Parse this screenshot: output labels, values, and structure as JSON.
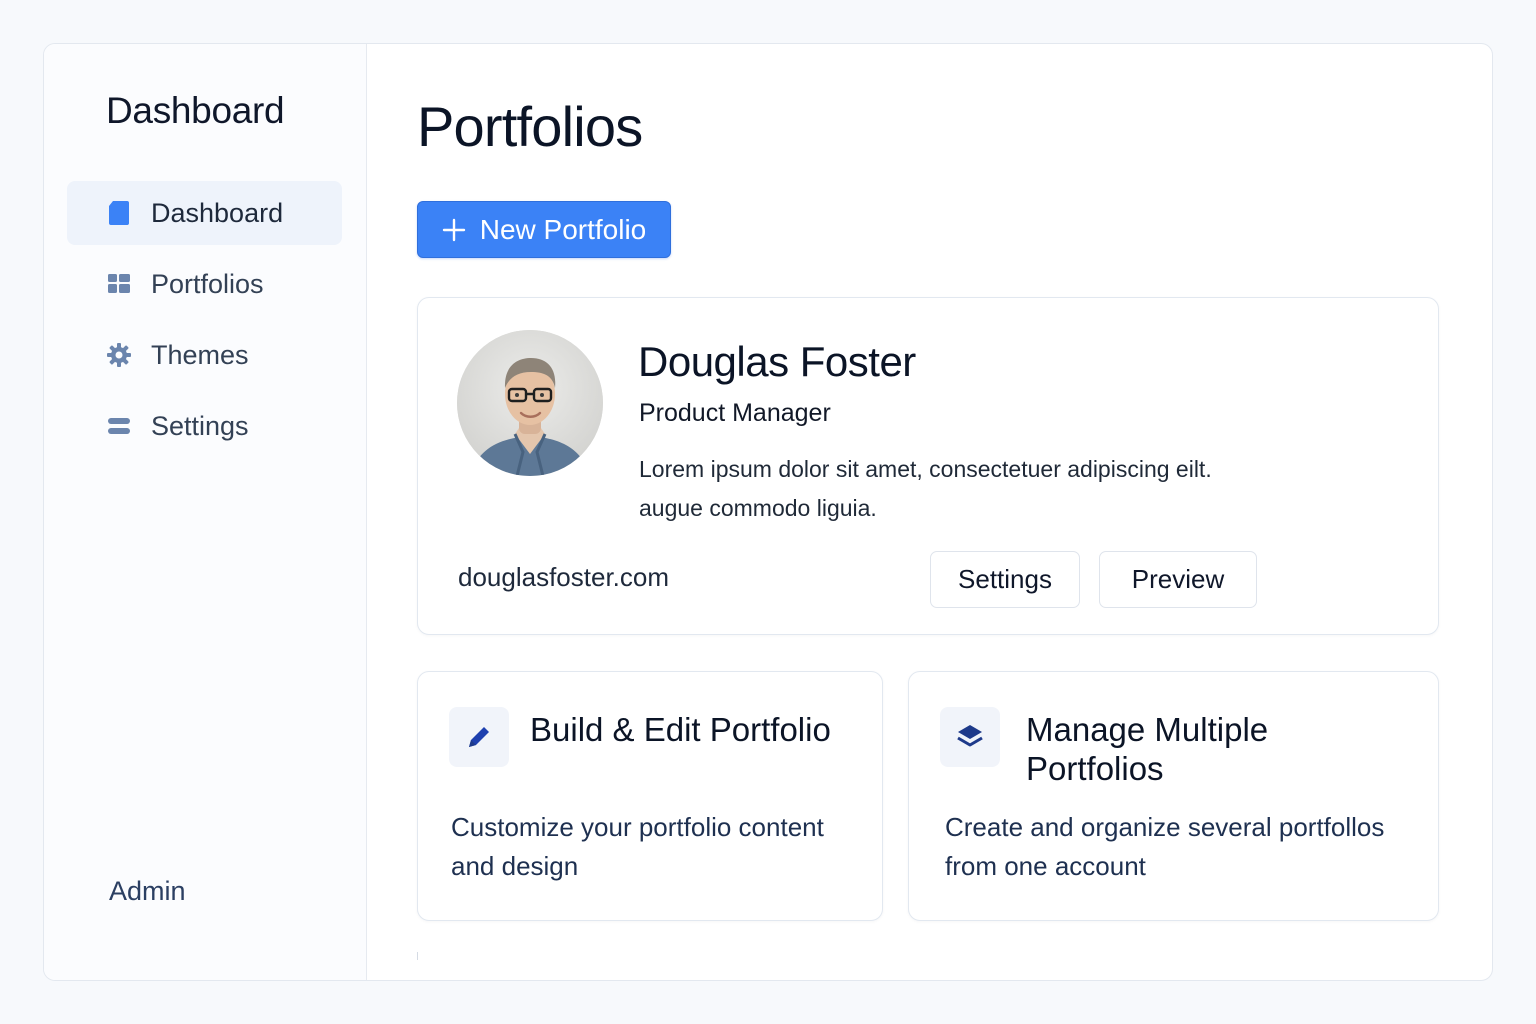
{
  "sidebar": {
    "brand": "Dashboard",
    "items": [
      {
        "label": "Dashboard",
        "icon": "document-icon",
        "active": true
      },
      {
        "label": "Portfolios",
        "icon": "grid-icon",
        "active": false
      },
      {
        "label": "Themes",
        "icon": "gear-icon",
        "active": false
      },
      {
        "label": "Settings",
        "icon": "toggle-lines-icon",
        "active": false
      }
    ],
    "footer_label": "Admin"
  },
  "main": {
    "title": "Portfolios",
    "new_button_label": "New Portfolio",
    "profile": {
      "name": "Douglas Foster",
      "role": "Product Manager",
      "bio": "Lorem ipsum dolor sit amet, consectetuer adipiscing eilt. augue commodo liguia.",
      "url": "douglasfoster.com",
      "settings_label": "Settings",
      "preview_label": "Preview"
    },
    "features": [
      {
        "title": "Build & Edit Portfolio",
        "description": "Customize your portfolio content and design",
        "icon": "pencil-icon"
      },
      {
        "title": "Manage Multiple Portfolios",
        "description": "Create and organize several portfollos from one account",
        "icon": "layers-icon"
      }
    ]
  },
  "colors": {
    "accent": "#3b82f6",
    "icon_blue": "#1e40af",
    "nav_icon": "#6b85ad"
  }
}
